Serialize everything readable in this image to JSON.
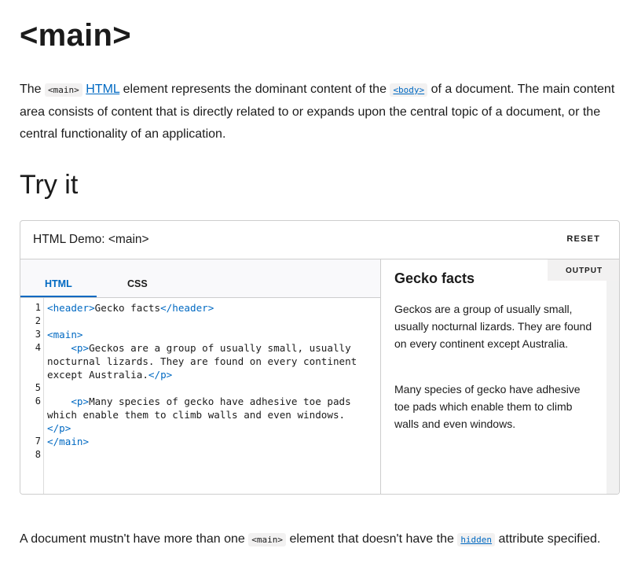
{
  "page": {
    "title": "<main>"
  },
  "intro": {
    "the": "The",
    "main_code": "<main>",
    "html_link": "HTML",
    "text1": "element represents the dominant content of the",
    "body_code": "<body>",
    "text2": "of a document. The main content area consists of content that is directly related to or expands upon the central topic of a document, or the central functionality of an application."
  },
  "section": {
    "title": "Try it"
  },
  "demo": {
    "title": "HTML Demo: <main>",
    "reset_label": "RESET",
    "tabs": [
      {
        "label": "HTML",
        "active": true
      },
      {
        "label": "CSS",
        "active": false
      }
    ],
    "line_numbers": [
      "1",
      "2",
      "3",
      "4",
      "5",
      "6",
      "7",
      "8"
    ],
    "output_label": "OUTPUT",
    "output": {
      "heading": "Gecko facts",
      "paragraphs": [
        "Geckos are a group of usually small, usually nocturnal lizards. They are found on every continent except Australia.",
        "Many species of gecko have adhesive toe pads which enable them to climb walls and even windows."
      ]
    },
    "code": {
      "l1_open": "<header>",
      "l1_text": "Gecko facts",
      "l1_close": "</header>",
      "l3_open": "<main>",
      "l4_open": "<p>",
      "l4_text_a": "Geckos are a group of usually small, usually",
      "l4_text_b": "nocturnal lizards. They are found on every continent",
      "l4_text_c": "except Australia.",
      "l4_close": "</p>",
      "l6_open": "<p>",
      "l6_text_a": "Many species of gecko have adhesive toe pads",
      "l6_text_b": "which enable them to climb walls and even windows.",
      "l6_close": "</p>",
      "l7_close": "</main>"
    }
  },
  "footer": {
    "text1": "A document mustn't have more than one",
    "main_code": "<main>",
    "text2": "element that doesn't have the",
    "hidden_code": "hidden",
    "text3": "attribute specified."
  },
  "colors": {
    "link": "#0069c2",
    "border": "#cdcdcd",
    "code_bg": "#f2f1f1"
  }
}
